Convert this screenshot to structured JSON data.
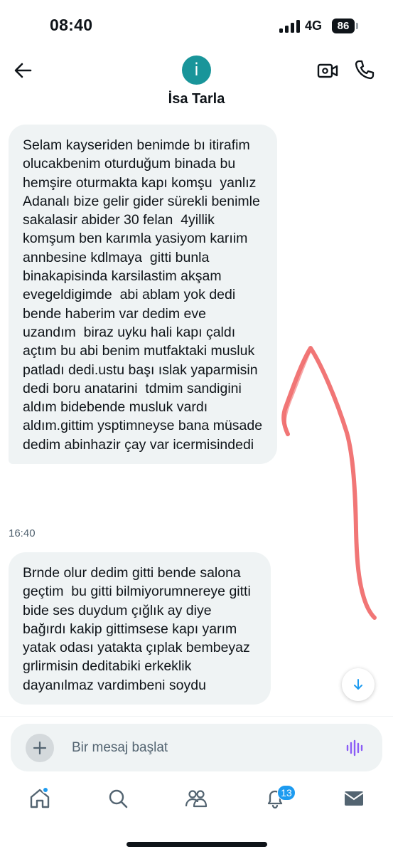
{
  "status_bar": {
    "time": "08:40",
    "network": "4G",
    "battery": "86"
  },
  "header": {
    "avatar_letter": "i",
    "contact_name": "İsa Tarla",
    "avatar_color": "#19959a"
  },
  "messages": [
    {
      "text": "Selam kayseriden benimde bı itirafim olucakbenim oturduğum binada bu hemşire oturmakta kapı komşu  yanlız Adanalı bize gelir gider sürekli benimle sakalasir abider 30 felan  4yillik komşum ben karımla yasiyom karıim annbesine kdlmaya  gitti bunla binakapisinda karsilastim akşam evegeldigimde  abi ablam yok dedi bende haberim var dedim eve uzandım  biraz uyku hali kapı çaldı  açtım bu abi benim mutfaktaki musluk patladı dedi.ustu başı ıslak yaparmisin dedi boru anatarini  tdmim sandigini aldım bidebende musluk vardı aldım.gittim ysptimneyse bana müsade dedim abinhazir çay var icermisindedi",
      "time": "16:40"
    },
    {
      "text": "Brnde olur dedim gitti bende salona geçtim  bu gitti bilmiyorumnereye gitti  bide ses duydum çığlık ay diye bağırdı kakip gittimsese kapı yarım yatak odası yatakta çıplak bembeyaz grlirmisin deditabiki erkeklik dayanılmaz vardimbeni soydu"
    }
  ],
  "composer": {
    "placeholder": "Bir mesaj başlat"
  },
  "bottom_nav": {
    "notification_count": "13",
    "items": [
      "home-icon",
      "search-icon",
      "communities-icon",
      "notifications-icon",
      "messages-icon"
    ]
  },
  "colors": {
    "accent": "#1d9bf0",
    "bubble_bg": "#eff3f4",
    "annotation_stroke": "#f06a6a",
    "voice_icon": "#8b5cf6"
  }
}
